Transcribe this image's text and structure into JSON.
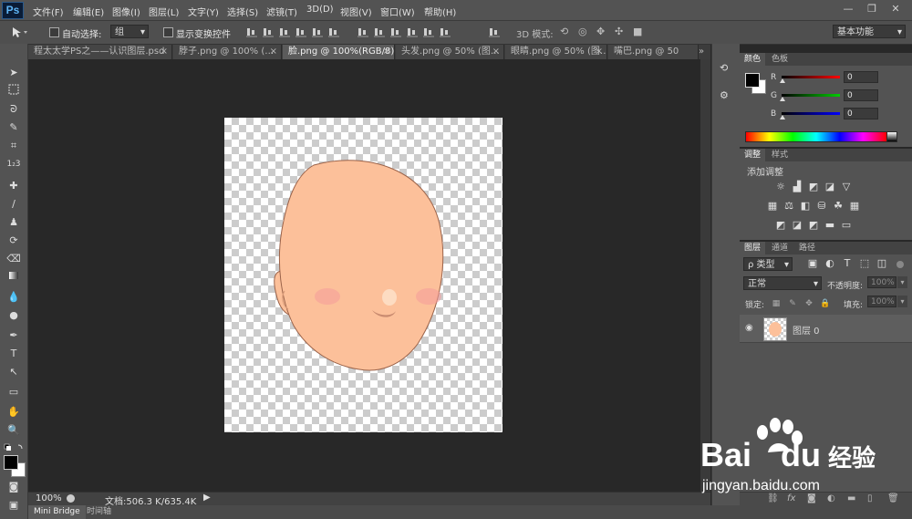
{
  "app": {
    "logo": "Ps"
  },
  "menu": [
    "文件(F)",
    "编辑(E)",
    "图像(I)",
    "图层(L)",
    "文字(Y)",
    "选择(S)",
    "滤镜(T)",
    "3D(D)",
    "视图(V)",
    "窗口(W)",
    "帮助(H)"
  ],
  "window_controls": {
    "minimize": "—",
    "restore": "❐",
    "close": "✕"
  },
  "options": {
    "auto_select_label": "自动选择:",
    "auto_select_value": "组",
    "show_transform_label": "显示变换控件",
    "mode_3d_label": "3D 模式:",
    "workspace_value": "基本功能"
  },
  "tabs": [
    {
      "label": "程太太学PS之——认识图层.psd",
      "active": false
    },
    {
      "label": "脖子.png @ 100% (…",
      "active": false
    },
    {
      "label": "脸.png @ 100%(RGB/8)",
      "active": true
    },
    {
      "label": "头发.png @ 50% (图…",
      "active": false
    },
    {
      "label": "眼睛.png @ 50% (图…",
      "active": false
    },
    {
      "label": "嘴巴.png @ 50",
      "active": false
    }
  ],
  "tab_close_glyph": "×",
  "tab_overflow_glyph": "»",
  "status": {
    "zoom": "100%",
    "doc_info": "文档:506.3 K/635.4K"
  },
  "bottom_tabs": [
    "Mini Bridge",
    "时间轴"
  ],
  "color_panel": {
    "tabs": [
      "颜色",
      "色板"
    ],
    "channels": [
      {
        "label": "R",
        "value": "0"
      },
      {
        "label": "G",
        "value": "0"
      },
      {
        "label": "B",
        "value": "0"
      }
    ]
  },
  "adjust_panel": {
    "tabs": [
      "调整",
      "样式"
    ],
    "title": "添加调整"
  },
  "layers_panel": {
    "tabs": [
      "图层",
      "通道",
      "路径"
    ],
    "filter_kind": "ρ 类型",
    "blend_mode": "正常",
    "opacity_label": "不透明度:",
    "opacity_value": "100%",
    "lock_label": "锁定:",
    "fill_label": "填充:",
    "fill_value": "100%",
    "layers": [
      {
        "name": "图层 0",
        "visible": true
      }
    ]
  },
  "colors": {
    "face": "#fcc09a",
    "face_outline": "#9a6249",
    "blush": "#f49a9a",
    "ps_blue": "#5fb5f5"
  },
  "watermark": {
    "brand": "Bai",
    "brand2": "du",
    "cn": "经验",
    "url": "jingyan.baidu.com"
  }
}
